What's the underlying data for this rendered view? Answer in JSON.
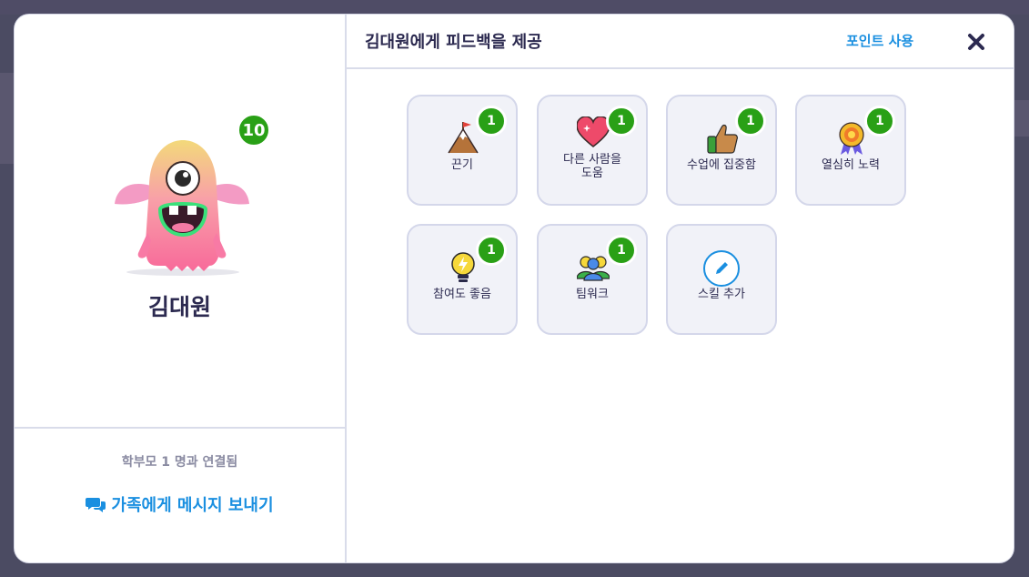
{
  "student": {
    "name": "김대원",
    "points": "10"
  },
  "left": {
    "parents_connected": "학부모 1 명과 연결됨",
    "message_family": "가족에게 메시지 보내기"
  },
  "header": {
    "title": "김대원에게 피드백을 제공",
    "use_points": "포인트 사용"
  },
  "skills": [
    {
      "label": "끈기",
      "count": "1",
      "icon": "mountain-flag-icon"
    },
    {
      "label": "다른 사람을 도움",
      "count": "1",
      "icon": "heart-icon"
    },
    {
      "label": "수업에 집중함",
      "count": "1",
      "icon": "thumbs-up-icon"
    },
    {
      "label": "열심히 노력",
      "count": "1",
      "icon": "medal-icon"
    },
    {
      "label": "참여도 좋음",
      "count": "1",
      "icon": "lightbulb-icon"
    },
    {
      "label": "팀워크",
      "count": "1",
      "icon": "team-icon"
    },
    {
      "label": "스킬 추가",
      "count": null,
      "icon": "pencil-icon"
    }
  ],
  "colors": {
    "accent_blue": "#1a8fe0",
    "badge_green": "#29a016",
    "text_dark": "#2c2a50",
    "card_bg": "#f1f2f8"
  }
}
